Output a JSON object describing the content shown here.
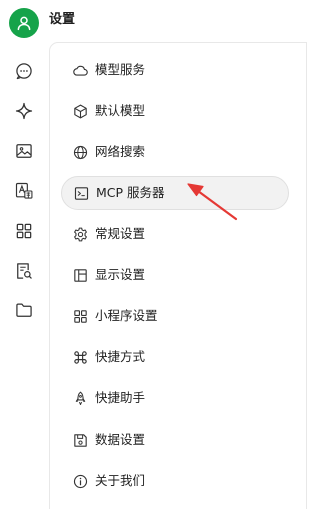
{
  "header": {
    "title": "设置"
  },
  "colors": {
    "avatar_bg": "#16a34a",
    "arrow": "#e53935",
    "active_bg": "#f2f2f2"
  },
  "rail": {
    "icons": [
      "chat-icon",
      "sparkle-icon",
      "image-icon",
      "translate-icon",
      "apps-grid-icon",
      "document-search-icon",
      "folder-icon"
    ]
  },
  "menu": {
    "items": [
      {
        "label": "模型服务",
        "icon": "cloud-icon"
      },
      {
        "label": "默认模型",
        "icon": "cube-icon"
      },
      {
        "label": "网络搜索",
        "icon": "globe-icon"
      },
      {
        "label": "MCP 服务器",
        "icon": "terminal-icon",
        "active": true
      },
      {
        "label": "常规设置",
        "icon": "gear-icon"
      },
      {
        "label": "显示设置",
        "icon": "layout-icon"
      },
      {
        "label": "小程序设置",
        "icon": "grid-icon"
      },
      {
        "label": "快捷方式",
        "icon": "command-key-icon"
      },
      {
        "label": "快捷助手",
        "icon": "rocket-icon"
      },
      {
        "label": "数据设置",
        "icon": "floppy-disk-icon"
      },
      {
        "label": "关于我们",
        "icon": "info-icon"
      }
    ]
  }
}
